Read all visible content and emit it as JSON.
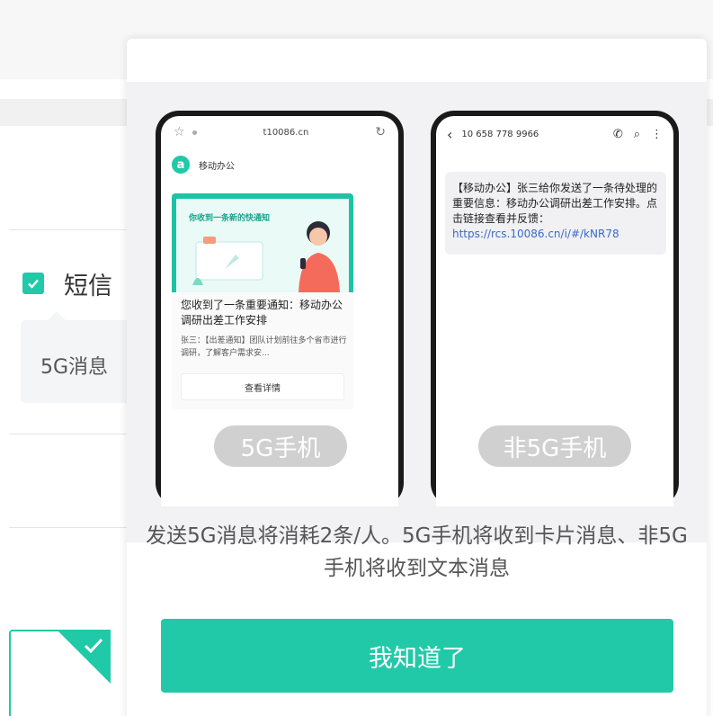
{
  "background": {
    "sms_option_label": "短信",
    "tip_text": "5G消息"
  },
  "dialog": {
    "phones": {
      "five_g": {
        "browser_url": "t10086.cn",
        "app_name": "移动办公",
        "banner_text": "你收到一条新的快通知",
        "card_title": "您收到了一条重要通知：移动办公调研出差工作安排",
        "card_desc": "张三：【出差通知】团队计划前往多个省市进行调研，了解客户需求安...",
        "card_button": "查看详情",
        "tag": "5G手机"
      },
      "non_five_g": {
        "sender_number": "10 658 778 9966",
        "sms_text": "【移动办公】张三给你发送了一条待处理的重要信息：移动办公调研出差工作安排。点击链接查看并反馈：",
        "sms_link": "https://rcs.10086.cn/i/#/kNR78",
        "tag": "非5G手机"
      }
    },
    "notice": "发送5G消息将消耗2条/人。5G手机将收到卡片消息、非5G手机将收到文本消息",
    "confirm_button": "我知道了"
  },
  "colors": {
    "accent": "#22c9a8",
    "link": "#3a6ac8"
  },
  "icons": [
    "check-icon",
    "star-icon",
    "reload-icon",
    "back-icon",
    "phone-icon",
    "search-icon",
    "more-icon"
  ]
}
